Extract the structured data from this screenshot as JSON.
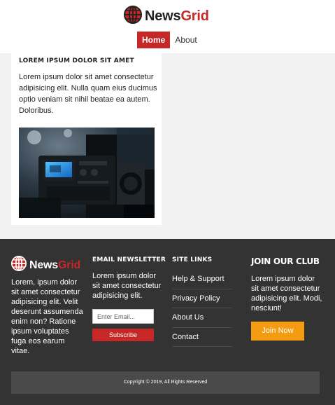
{
  "brand": {
    "name_part1": "News",
    "name_part2": "Grid",
    "accent_color": "#c62828",
    "icon": "globe-icon"
  },
  "nav": {
    "items": [
      {
        "label": "Home",
        "active": true
      },
      {
        "label": "About",
        "active": false
      }
    ]
  },
  "article": {
    "title": "LOREM IPSUM DOLOR SIT AMET",
    "body": "Lorem ipsum dolor sit amet consectetur adipisicing elit. Nulla quam eius ducimus optio veniam sit nihil beatae ea autem. Doloribus.",
    "image": "video-camera-photo"
  },
  "footer": {
    "about_text": "Lorem, ipsum dolor sit amet consectetur adipisicing elit. Velit deserunt assumenda enim non? Ratione ipsum voluptates fuga eos earum vitae.",
    "newsletter": {
      "heading": "EMAIL NEWSLETTER",
      "text": "Lorem ipsum dolor sit amet consectetur adipisicing elit.",
      "placeholder": "Enter Email...",
      "button": "Subscribe"
    },
    "site_links": {
      "heading": "SITE LINKS",
      "items": [
        "Help & Support",
        "Privacy Policy",
        "About Us",
        "Contact"
      ]
    },
    "club": {
      "heading": "JOIN OUR CLUB",
      "text": "Lorem ipsum dolor sit amet consectetur adipisicing elit. Modi, nesciunt!",
      "button": "Join Now",
      "button_color": "#f39c12"
    },
    "copyright": "Copyright © 2019, All Rights Reserved"
  }
}
